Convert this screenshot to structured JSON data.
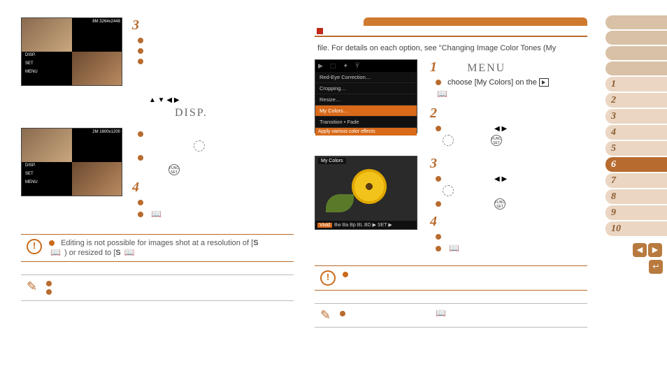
{
  "left": {
    "step3": {
      "num": "3",
      "label": "",
      "lcd_res": "8M 3264x2448",
      "osd": [
        "DISP.",
        "SET",
        "MENU"
      ]
    },
    "disp_label": "DISP.",
    "arrows_hint": "▲  ▼  ◀  ▶",
    "step4": {
      "num": "4",
      "label": "",
      "lcd_res": "2M 1600x1200",
      "osd": [
        "DISP.",
        "SET",
        "MENU"
      ]
    },
    "warn_text_a": "Editing is not possible for images shot at a resolution of [",
    "warn_text_b": "S",
    "warn_text_c": ") or resized to [",
    "warn_text_d": "S",
    "note_text": ""
  },
  "right": {
    "intro": "file. For details on each option, see \"Changing Image Color Tones (My",
    "menu_items": [
      "Red-Eye Correction…",
      "Cropping…",
      "Resize…",
      "My Colors…",
      "Transition        • Fade"
    ],
    "menu_caption": "Apply various color effects",
    "flower_top": "My Colors",
    "flower_tag": "Vivid",
    "flower_strip": "Bw  Ba  Bp  BL  BD  ▶ SET ▶",
    "steps": {
      "s1": {
        "num": "1",
        "label": "MENU",
        "text_a": "choose [My Colors] on the "
      },
      "s2": {
        "num": "2"
      },
      "s3": {
        "num": "3"
      },
      "s4": {
        "num": "4"
      }
    },
    "arrows_lr": "◀  ▶"
  },
  "sidebar": {
    "tabs": [
      "1",
      "2",
      "3",
      "4",
      "5",
      "6",
      "7",
      "8",
      "9",
      "10"
    ],
    "active": "6",
    "nav": {
      "prev": "◀",
      "next": "▶",
      "return": "↩"
    }
  },
  "icons": {
    "book": "📖"
  }
}
